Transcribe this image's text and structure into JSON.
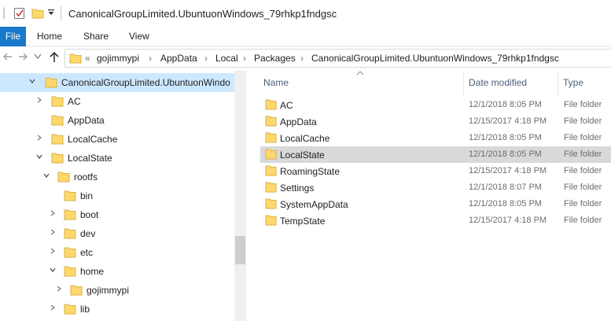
{
  "window": {
    "title": "CanonicalGroupLimited.UbuntuonWindows_79rhkp1fndgsc"
  },
  "ribbon": {
    "tabs": [
      {
        "label": "File"
      },
      {
        "label": "Home"
      },
      {
        "label": "Share"
      },
      {
        "label": "View"
      }
    ]
  },
  "address": {
    "overflow": "«",
    "crumbs": [
      {
        "label": "gojimmypi"
      },
      {
        "label": "AppData"
      },
      {
        "label": "Local"
      },
      {
        "label": "Packages"
      },
      {
        "label": "CanonicalGroupLimited.UbuntuonWindows_79rhkp1fndgsc"
      }
    ],
    "separator": "›"
  },
  "nav_pane": {
    "items": [
      {
        "label": "CanonicalGroupLimited.UbuntuonWindo",
        "expanded": true,
        "selected": true
      },
      {
        "label": "AC",
        "expanded": false
      },
      {
        "label": "AppData"
      },
      {
        "label": "LocalCache",
        "expanded": false
      },
      {
        "label": "LocalState",
        "expanded": true
      },
      {
        "label": "rootfs",
        "expanded": true
      },
      {
        "label": "bin"
      },
      {
        "label": "boot",
        "expanded": false
      },
      {
        "label": "dev",
        "expanded": false
      },
      {
        "label": "etc",
        "expanded": false
      },
      {
        "label": "home",
        "expanded": true
      },
      {
        "label": "gojimmypi",
        "expanded": false
      },
      {
        "label": "lib",
        "expanded": false
      }
    ]
  },
  "file_list": {
    "columns": {
      "name": "Name",
      "date": "Date modified",
      "type": "Type"
    },
    "rows": [
      {
        "name": "AC",
        "date": "12/1/2018 8:05 PM",
        "type": "File folder"
      },
      {
        "name": "AppData",
        "date": "12/15/2017 4:18 PM",
        "type": "File folder"
      },
      {
        "name": "LocalCache",
        "date": "12/1/2018 8:05 PM",
        "type": "File folder"
      },
      {
        "name": "LocalState",
        "date": "12/1/2018 8:05 PM",
        "type": "File folder",
        "selected": true
      },
      {
        "name": "RoamingState",
        "date": "12/15/2017 4:18 PM",
        "type": "File folder"
      },
      {
        "name": "Settings",
        "date": "12/1/2018 8:07 PM",
        "type": "File folder"
      },
      {
        "name": "SystemAppData",
        "date": "12/1/2018 8:05 PM",
        "type": "File folder"
      },
      {
        "name": "TempState",
        "date": "12/15/2017 4:18 PM",
        "type": "File folder"
      }
    ]
  },
  "colors": {
    "file_tab": "#1979ca",
    "tree_selected": "#cce8ff",
    "row_selected": "#d9d9d9",
    "folder_yellow": "#ffd86b"
  }
}
